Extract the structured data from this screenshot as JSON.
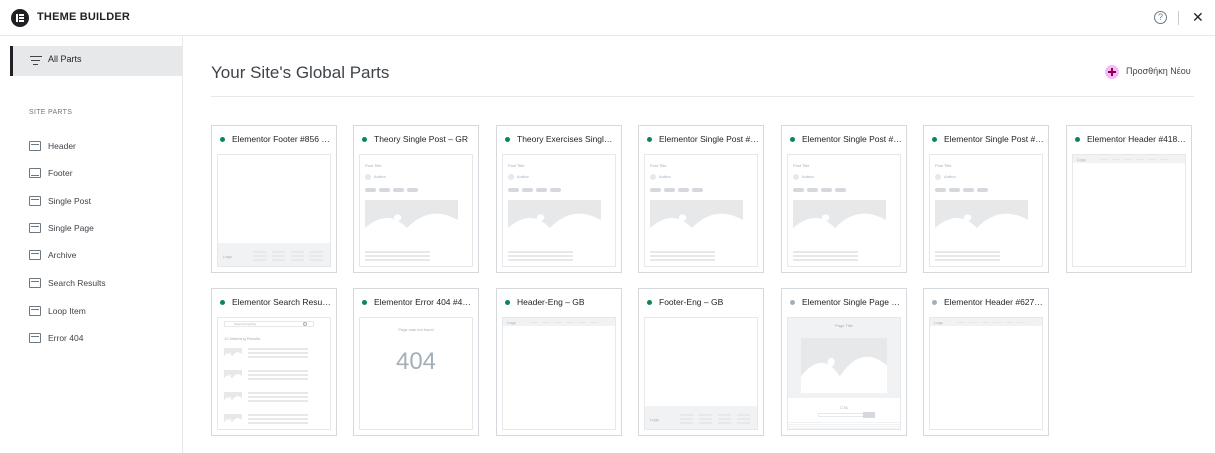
{
  "app": {
    "title": "THEME BUILDER",
    "info_icon": "info-circle-icon",
    "close_icon": "close-icon",
    "close_glyph": "✕",
    "info_glyph": "?"
  },
  "sidebar": {
    "all_parts_label": "All Parts",
    "section_title": "SITE PARTS",
    "items": [
      {
        "label": "Header",
        "icon": "header-icon"
      },
      {
        "label": "Footer",
        "icon": "footer-icon"
      },
      {
        "label": "Single Post",
        "icon": "single-post-icon"
      },
      {
        "label": "Single Page",
        "icon": "single-page-icon"
      },
      {
        "label": "Archive",
        "icon": "archive-icon"
      },
      {
        "label": "Search Results",
        "icon": "search-results-icon"
      },
      {
        "label": "Loop Item",
        "icon": "loop-item-icon"
      },
      {
        "label": "Error 404",
        "icon": "error-404-icon"
      }
    ]
  },
  "main": {
    "title": "Your Site's Global Parts",
    "add_new_label": "Προσθήκη Νέου",
    "cards": [
      {
        "name": "Elementor Footer #856 – ...",
        "status": "published",
        "thumb": "footer"
      },
      {
        "name": "Theory Single Post – GR",
        "status": "published",
        "thumb": "post"
      },
      {
        "name": "Theory Exercises Single ...",
        "status": "published",
        "thumb": "post"
      },
      {
        "name": "Elementor Single Post #3...",
        "status": "published",
        "thumb": "post"
      },
      {
        "name": "Elementor Single Post #3...",
        "status": "published",
        "thumb": "post"
      },
      {
        "name": "Elementor Single Post #4...",
        "status": "published",
        "thumb": "post"
      },
      {
        "name": "Elementor Header #4180 ...",
        "status": "published",
        "thumb": "header"
      },
      {
        "name": "Elementor Search Result...",
        "status": "published",
        "thumb": "search"
      },
      {
        "name": "Elementor Error 404 #49...",
        "status": "published",
        "thumb": "error404"
      },
      {
        "name": "Header-Eng – GB",
        "status": "published",
        "thumb": "header"
      },
      {
        "name": "Footer-Eng – GB",
        "status": "published",
        "thumb": "footer"
      },
      {
        "name": "Elementor Single Page #...",
        "status": "draft",
        "thumb": "page"
      },
      {
        "name": "Elementor Header #6270 ...",
        "status": "draft",
        "thumb": "header"
      }
    ]
  },
  "thumbs": {
    "post_title": "Post Title",
    "author": "Author",
    "logo": "Logo",
    "page_title": "Page Title",
    "cta": "CTA",
    "search_placeholder": "Search Anything",
    "matching": "12 Matching Results",
    "not_found": "Page was not found",
    "code_404": "404"
  }
}
